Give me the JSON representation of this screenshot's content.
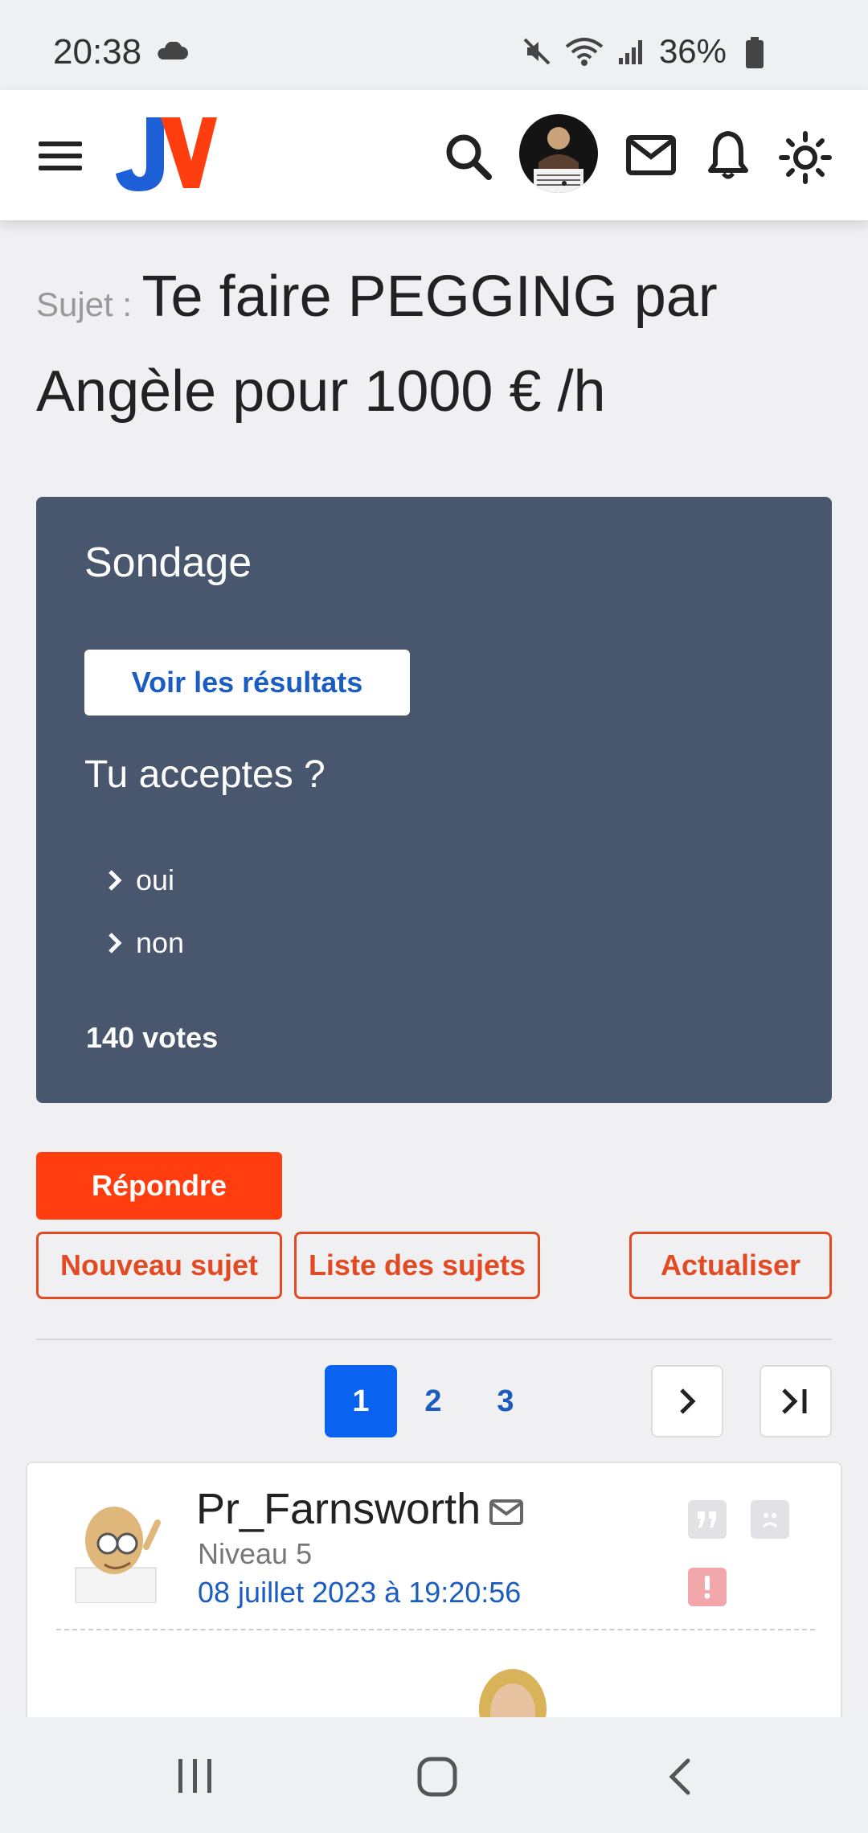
{
  "status_bar": {
    "time": "20:38",
    "battery": "36%"
  },
  "header": {
    "logo": "JV"
  },
  "topic": {
    "prefix": "Sujet :",
    "title": "Te faire PEGGING par Angèle pour 1000 € /h"
  },
  "poll": {
    "title": "Sondage",
    "results_button": "Voir les résultats",
    "question": "Tu acceptes ?",
    "options": [
      "oui",
      "non"
    ],
    "votes": "140 votes"
  },
  "actions": {
    "reply": "Répondre",
    "new_topic": "Nouveau sujet",
    "topic_list": "Liste des sujets",
    "refresh": "Actualiser"
  },
  "pagination": {
    "pages": [
      "1",
      "2",
      "3"
    ],
    "current": "1"
  },
  "post": {
    "author": "Pr_Farnsworth",
    "level": "Niveau 5",
    "date": "08 juillet 2023 à 19:20:56"
  },
  "colors": {
    "accent": "#ff3d0e",
    "link": "#1a5cc0",
    "poll_bg": "#48566e",
    "page_active": "#0a63f0"
  }
}
